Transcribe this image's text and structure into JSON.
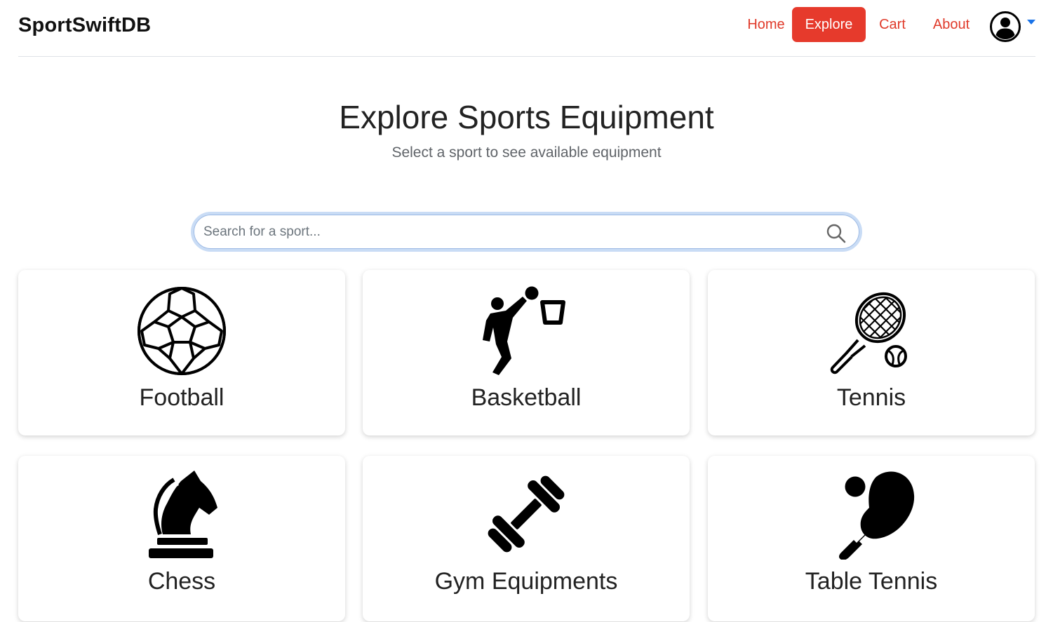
{
  "navbar": {
    "brand": "SportSwiftDB",
    "links": [
      {
        "label": "Home",
        "active": false
      },
      {
        "label": "Explore",
        "active": true
      },
      {
        "label": "Cart",
        "active": false
      },
      {
        "label": "About",
        "active": false
      }
    ],
    "profile_icon": "user-circle-icon",
    "dropdown_icon": "caret-down-icon"
  },
  "header": {
    "title": "Explore Sports Equipment",
    "subtitle": "Select a sport to see available equipment"
  },
  "search": {
    "placeholder": "Search for a sport...",
    "value": "",
    "icon": "search-icon"
  },
  "sports": [
    {
      "label": "Football",
      "icon": "soccer-ball-icon"
    },
    {
      "label": "Basketball",
      "icon": "basketball-player-icon"
    },
    {
      "label": "Tennis",
      "icon": "tennis-racket-icon"
    },
    {
      "label": "Chess",
      "icon": "chess-knight-icon"
    },
    {
      "label": "Gym Equipments",
      "icon": "dumbbell-icon"
    },
    {
      "label": "Table Tennis",
      "icon": "ping-pong-paddle-icon"
    }
  ],
  "colors": {
    "accent": "#e63a2c",
    "nav_link": "#e03a2a",
    "caret": "#1a73e8",
    "search_focus": "#c9dcf5"
  }
}
